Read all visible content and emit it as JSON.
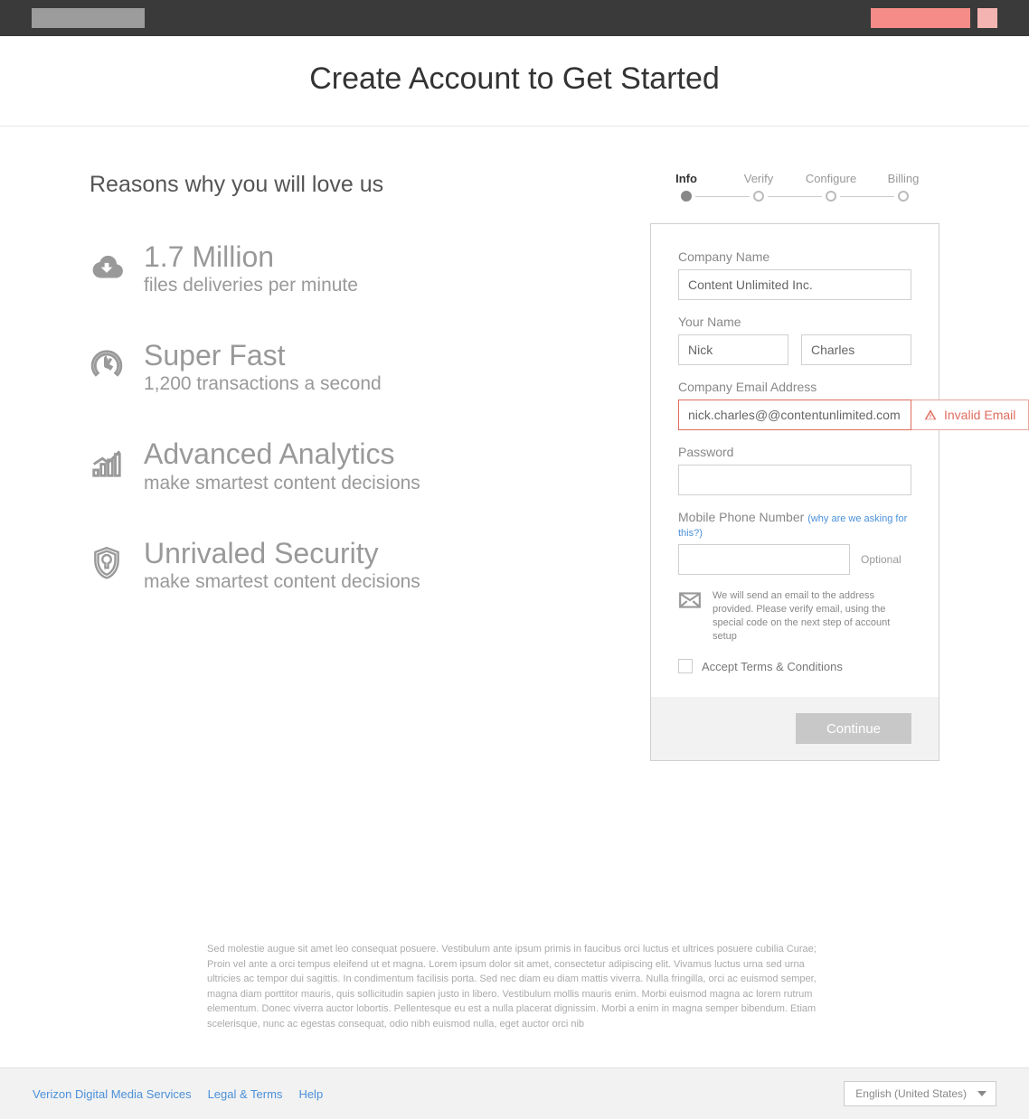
{
  "hero": {
    "title": "Create Account to Get Started"
  },
  "left": {
    "title": "Reasons why you will love us",
    "features": [
      {
        "title": "1.7 Million",
        "subtitle": "files deliveries per minute"
      },
      {
        "title": "Super Fast",
        "subtitle": "1,200 transactions a second"
      },
      {
        "title": "Advanced Analytics",
        "subtitle": "make smartest content decisions"
      },
      {
        "title": "Unrivaled Security",
        "subtitle": "make smartest content decisions"
      }
    ]
  },
  "steps": [
    {
      "label": "Info",
      "active": true
    },
    {
      "label": "Verify",
      "active": false
    },
    {
      "label": "Configure",
      "active": false
    },
    {
      "label": "Billing",
      "active": false
    }
  ],
  "form": {
    "company_label": "Company Name",
    "company_value": "Content Unlimited Inc.",
    "name_label": "Your Name",
    "first_name": "Nick",
    "last_name": "Charles",
    "email_label": "Company Email Address",
    "email_value": "nick.charles@@contentunlimited.com",
    "email_error": "Invalid Email",
    "password_label": "Password",
    "password_value": "",
    "phone_label": "Mobile Phone Number",
    "phone_hint": "(why are we asking for this?)",
    "phone_value": "",
    "optional_label": "Optional",
    "notice": "We will send an email to the address provided. Please verify email, using the special code on the next step of account setup",
    "terms_label": "Accept Terms & Conditions",
    "continue_label": "Continue"
  },
  "legal_text": "Sed molestie augue sit amet leo consequat posuere. Vestibulum ante ipsum primis in faucibus orci luctus et ultrices posuere cubilia Curae; Proin vel ante a orci tempus eleifend ut et magna. Lorem ipsum dolor sit amet, consectetur adipiscing elit. Vivamus luctus urna sed urna ultricies ac tempor dui sagittis. In condimentum facilisis porta. Sed nec diam eu diam mattis viverra. Nulla fringilla, orci ac euismod semper, magna diam porttitor mauris, quis sollicitudin sapien justo in libero. Vestibulum mollis mauris enim. Morbi euismod magna ac lorem rutrum elementum. Donec viverra auctor lobortis. Pellentesque eu est a nulla placerat dignissim. Morbi a enim in magna semper bibendum. Etiam scelerisque, nunc ac egestas consequat, odio nibh euismod nulla, eget auctor orci nib",
  "footer": {
    "links": [
      {
        "label": "Verizon Digital Media Services"
      },
      {
        "label": "Legal & Terms"
      },
      {
        "label": "Help"
      }
    ],
    "lang": "English (United States)"
  }
}
